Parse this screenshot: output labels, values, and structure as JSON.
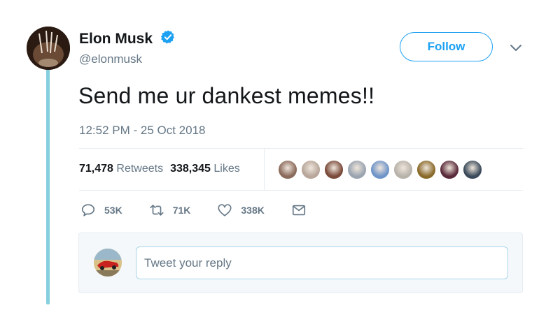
{
  "author": {
    "name": "Elon Musk",
    "handle": "@elonmusk",
    "verified": true,
    "avatar_icon": "avatar-photo"
  },
  "follow_label": "Follow",
  "tweet": {
    "text": "Send me ur dankest memes!!",
    "timestamp": "12:52 PM - 25 Oct 2018"
  },
  "stats": {
    "retweets_count": "71,478",
    "retweets_label": "Retweets",
    "likes_count": "338,345",
    "likes_label": "Likes"
  },
  "likers": [
    {
      "color": "#8a6a5a"
    },
    {
      "color": "#b8a69a"
    },
    {
      "color": "#7a4a3a"
    },
    {
      "color": "#9aa4b0"
    },
    {
      "color": "#6f94c8"
    },
    {
      "color": "#b7b2aa"
    },
    {
      "color": "#8a6a2a"
    },
    {
      "color": "#5a2a3a"
    },
    {
      "color": "#3a4a5a"
    }
  ],
  "actions": {
    "replies": "53K",
    "retweets": "71K",
    "likes": "338K"
  },
  "reply": {
    "placeholder": "Tweet your reply"
  },
  "colors": {
    "accent": "#1da1f2",
    "thread_line": "#86cfdf",
    "muted_text": "#657786"
  }
}
